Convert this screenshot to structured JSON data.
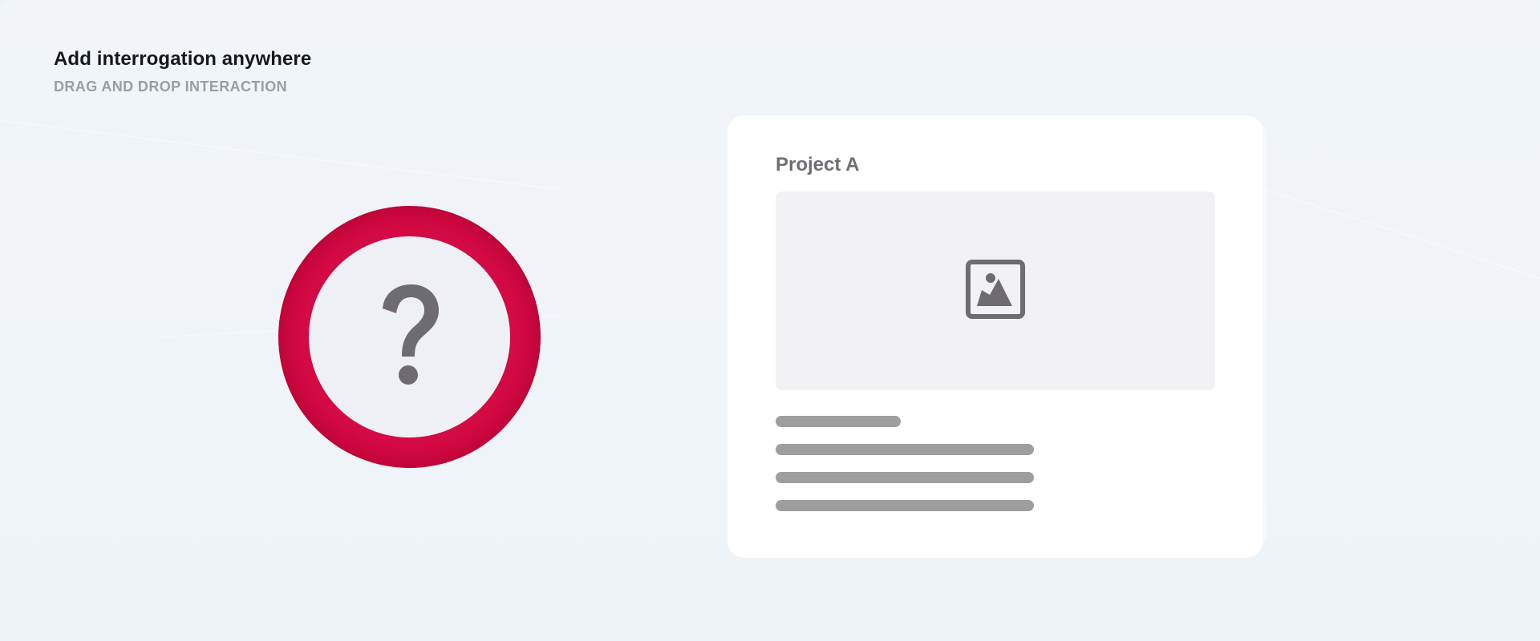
{
  "header": {
    "title": "Add interrogation anywhere",
    "subtitle": "DRAG AND DROP INTERACTION"
  },
  "badge": {
    "icon": "question-mark-icon",
    "ring_color": "#d40a44",
    "inner_color": "#eef0f5",
    "glyph_color": "#6e6b72"
  },
  "card": {
    "title": "Project A",
    "image_icon": "image-icon"
  },
  "colors": {
    "background": "#eef3f8",
    "title_text": "#15181d",
    "subtitle_text": "#9a9da3",
    "placeholder_line": "#9e9e9e"
  }
}
